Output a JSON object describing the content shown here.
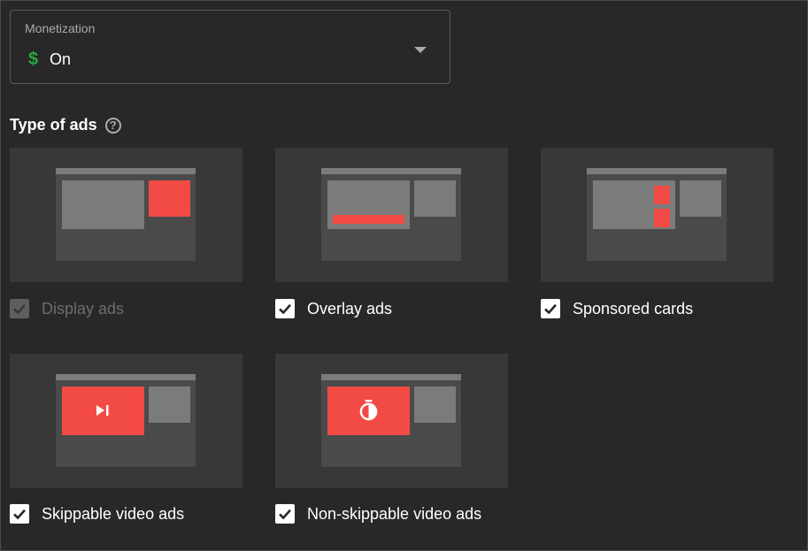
{
  "monetization": {
    "label": "Monetization",
    "value": "On",
    "value_icon": "dollar-icon",
    "dollar_glyph": "$",
    "accent_color": "#2ba640"
  },
  "ad_types": {
    "title": "Type of ads",
    "help_glyph": "?",
    "options": [
      {
        "label": "Display ads",
        "checked": true,
        "disabled": true
      },
      {
        "label": "Overlay ads",
        "checked": true,
        "disabled": false
      },
      {
        "label": "Sponsored cards",
        "checked": true,
        "disabled": false
      },
      {
        "label": "Skippable video ads",
        "checked": true,
        "disabled": false
      },
      {
        "label": "Non-skippable video ads",
        "checked": true,
        "disabled": false
      }
    ]
  },
  "colors": {
    "background": "#282828",
    "card": "#383838",
    "ad_red": "#f24b45",
    "placeholder_gray": "#7b7b7b"
  }
}
